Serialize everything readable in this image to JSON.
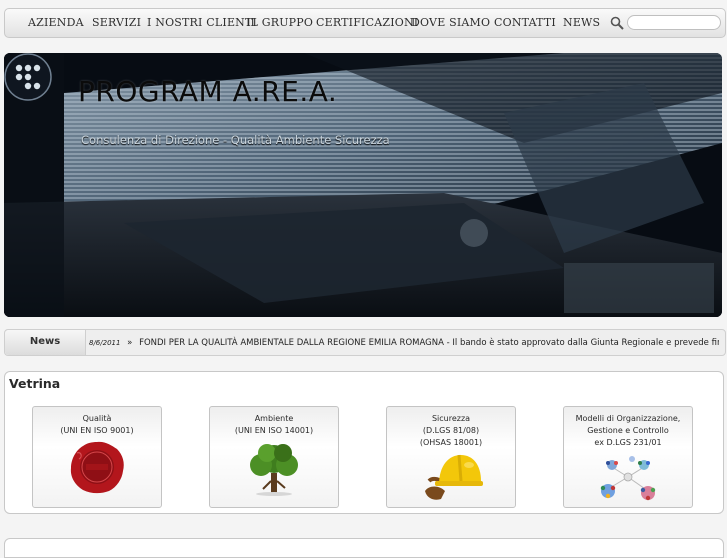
{
  "nav": {
    "items": [
      "AZIENDA",
      "SERVIZI",
      "I NOSTRI CLIENTI",
      "IL GRUPPO",
      "CERTIFICAZIONI",
      "DOVE SIAMO",
      "CONTATTI",
      "NEWS"
    ],
    "search_placeholder": ""
  },
  "hero": {
    "brand": "PROGRAM A.RE.A.",
    "tagline": "Consulenza di Direzione - Qualità Ambiente Sicurezza"
  },
  "news": {
    "label": "News",
    "date": "8/6/2011",
    "separator": "»",
    "text": "FONDI PER LA QUALITÀ AMBIENTALE DALLA REGIONE EMILIA ROMAGNA - Il bando è stato approvato dalla Giunta Regionale e prevede finanzi..."
  },
  "vetrina": {
    "title": "Vetrina",
    "cards": [
      {
        "title": "Qualità\n(UNI EN ISO 9001)",
        "icon": "wax-seal-icon"
      },
      {
        "title": "Ambiente\n(UNI EN ISO 14001)",
        "icon": "tree-icon"
      },
      {
        "title": "Sicurezza\n(D.LGS 81/08)\n(OHSAS 18001)",
        "icon": "hard-hat-icon"
      },
      {
        "title": "Modelli di Organizzazione,\nGestione e Controllo\nex D.LGS 231/01",
        "icon": "people-network-icon"
      }
    ]
  },
  "colors": {
    "nav_bg": "#e8e8e8",
    "hero_bg": "#060b12",
    "seal_red": "#b3161c",
    "tree_green": "#3f7d1e",
    "hat_yellow": "#f3c70a"
  }
}
